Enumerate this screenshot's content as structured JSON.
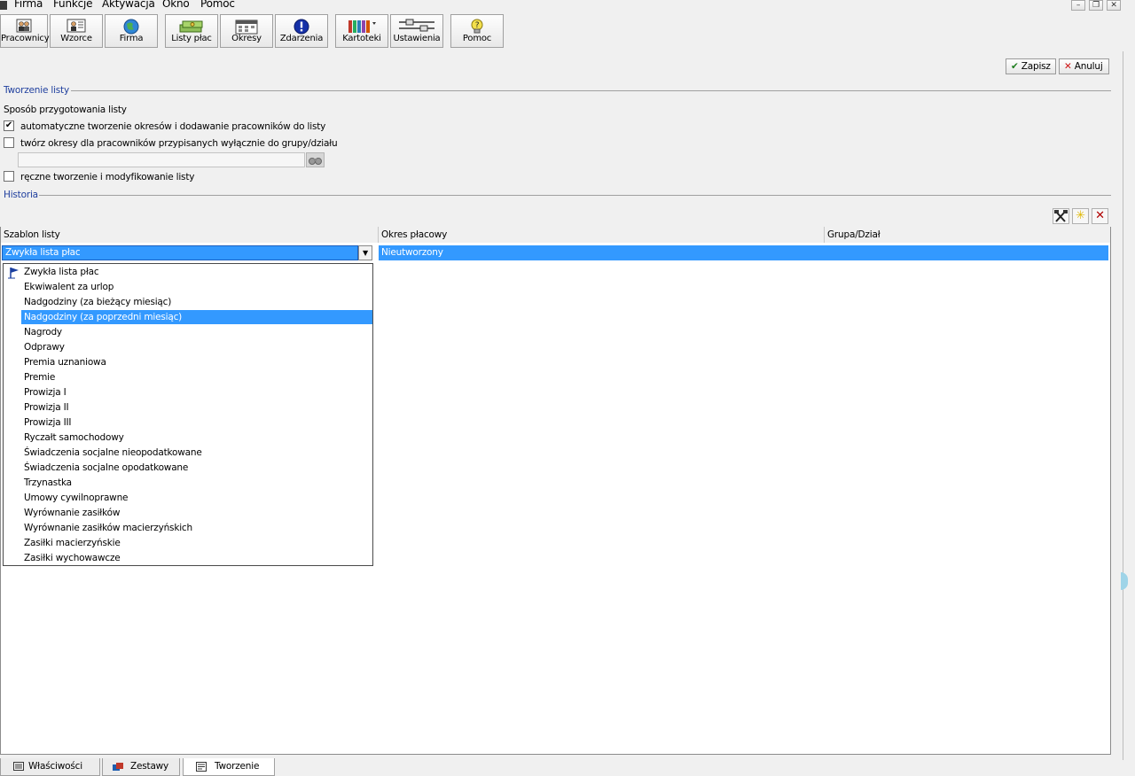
{
  "menu": [
    "Firma",
    "Funkcje",
    "Aktywacja",
    "Okno",
    "Pomoc"
  ],
  "window_controls": {
    "minimize": "–",
    "restore": "❐",
    "close": "✕"
  },
  "toolbar": [
    {
      "label": "Pracownicy",
      "icon": "people-icon"
    },
    {
      "label": "Wzorce",
      "icon": "templates-icon"
    },
    {
      "label": "Firma",
      "icon": "globe-icon"
    },
    {
      "label": "Listy płac",
      "icon": "money-icon"
    },
    {
      "label": "Okresy",
      "icon": "calendar-icon"
    },
    {
      "label": "Zdarzenia",
      "icon": "exclamation-icon"
    },
    {
      "label": "Kartoteki",
      "icon": "binders-icon"
    },
    {
      "label": "Ustawienia",
      "icon": "sliders-icon"
    },
    {
      "label": "Pomoc",
      "icon": "help-bulb-icon"
    }
  ],
  "actions": {
    "save": "Zapisz",
    "cancel": "Anuluj"
  },
  "creation": {
    "title": "Tworzenie listy",
    "method_label": "Sposób przygotowania listy",
    "opt_auto": "automatyczne tworzenie okresów i dodawanie pracowników do listy",
    "opt_auto_checked": true,
    "opt_group": "twórz okresy dla pracowników przypisanych wyłącznie do grupy/działu",
    "opt_group_checked": false,
    "group_field_value": "",
    "opt_manual": "ręczne tworzenie i modyfikowanie listy",
    "opt_manual_checked": false
  },
  "history": {
    "title": "Historia"
  },
  "grid": {
    "columns": [
      "Szablon listy",
      "Okres płacowy",
      "Grupa/Dział"
    ],
    "row": {
      "template": "Zwykła lista płac",
      "period": "Nieutworzony",
      "group": ""
    }
  },
  "dropdown": {
    "items": [
      "Zwykła lista płac",
      "Ekwiwalent za urlop",
      "Nadgodziny (za bieżący miesiąc)",
      "Nadgodziny (za poprzedni miesiąc)",
      "Nagrody",
      "Odprawy",
      "Premia uznaniowa",
      "Premie",
      "Prowizja I",
      "Prowizja II",
      "Prowizja III",
      "Ryczałt samochodowy",
      "Świadczenia socjalne nieopodatkowane",
      "Świadczenia socjalne opodatkowane",
      "Trzynastka",
      "Umowy cywilnoprawne",
      "Wyrównanie zasiłków",
      "Wyrównanie zasiłków macierzyńskich",
      "Zasiłki macierzyńskie",
      "Zasiłki wychowawcze"
    ],
    "selected_index": 3
  },
  "tabs": [
    "Właściwości",
    "Zestawy",
    "Tworzenie"
  ],
  "active_tab": "Tworzenie",
  "colors": {
    "selection": "#3399ff",
    "group_title": "#1f3f9e"
  }
}
